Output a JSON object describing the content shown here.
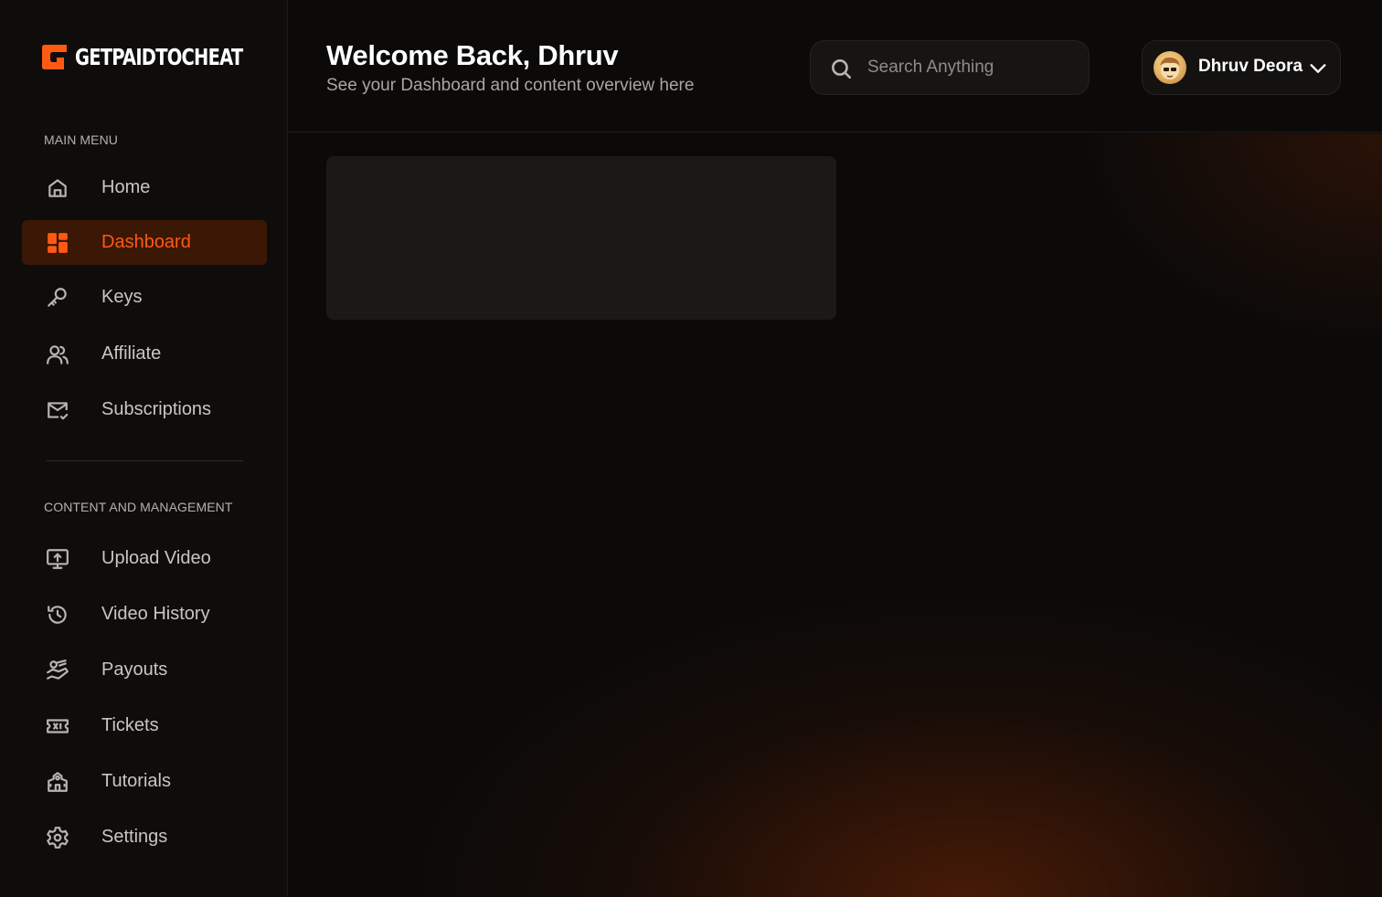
{
  "brand": {
    "name": "GETPAIDTOCHEAT",
    "accent": "#ff5a12"
  },
  "sidebar": {
    "main_menu_label": "MAIN MENU",
    "content_label": "CONTENT AND MANAGEMENT",
    "main_items": [
      {
        "label": "Home",
        "icon": "home-icon"
      },
      {
        "label": "Dashboard",
        "icon": "dashboard-icon",
        "active": true
      },
      {
        "label": "Keys",
        "icon": "key-icon"
      },
      {
        "label": "Affiliate",
        "icon": "users-icon"
      },
      {
        "label": "Subscriptions",
        "icon": "mail-check-icon"
      }
    ],
    "content_items": [
      {
        "label": "Upload Video",
        "icon": "monitor-upload-icon"
      },
      {
        "label": "Video History",
        "icon": "history-icon"
      },
      {
        "label": "Payouts",
        "icon": "hand-coins-icon"
      },
      {
        "label": "Tickets",
        "icon": "ticket-icon"
      },
      {
        "label": "Tutorials",
        "icon": "school-icon"
      },
      {
        "label": "Settings",
        "icon": "gear-icon"
      }
    ]
  },
  "header": {
    "title": "Welcome Back, Dhruv",
    "subtitle": "See your Dashboard and content overview here",
    "search_placeholder": "Search Anything",
    "user_name": "Dhruv Deora"
  }
}
